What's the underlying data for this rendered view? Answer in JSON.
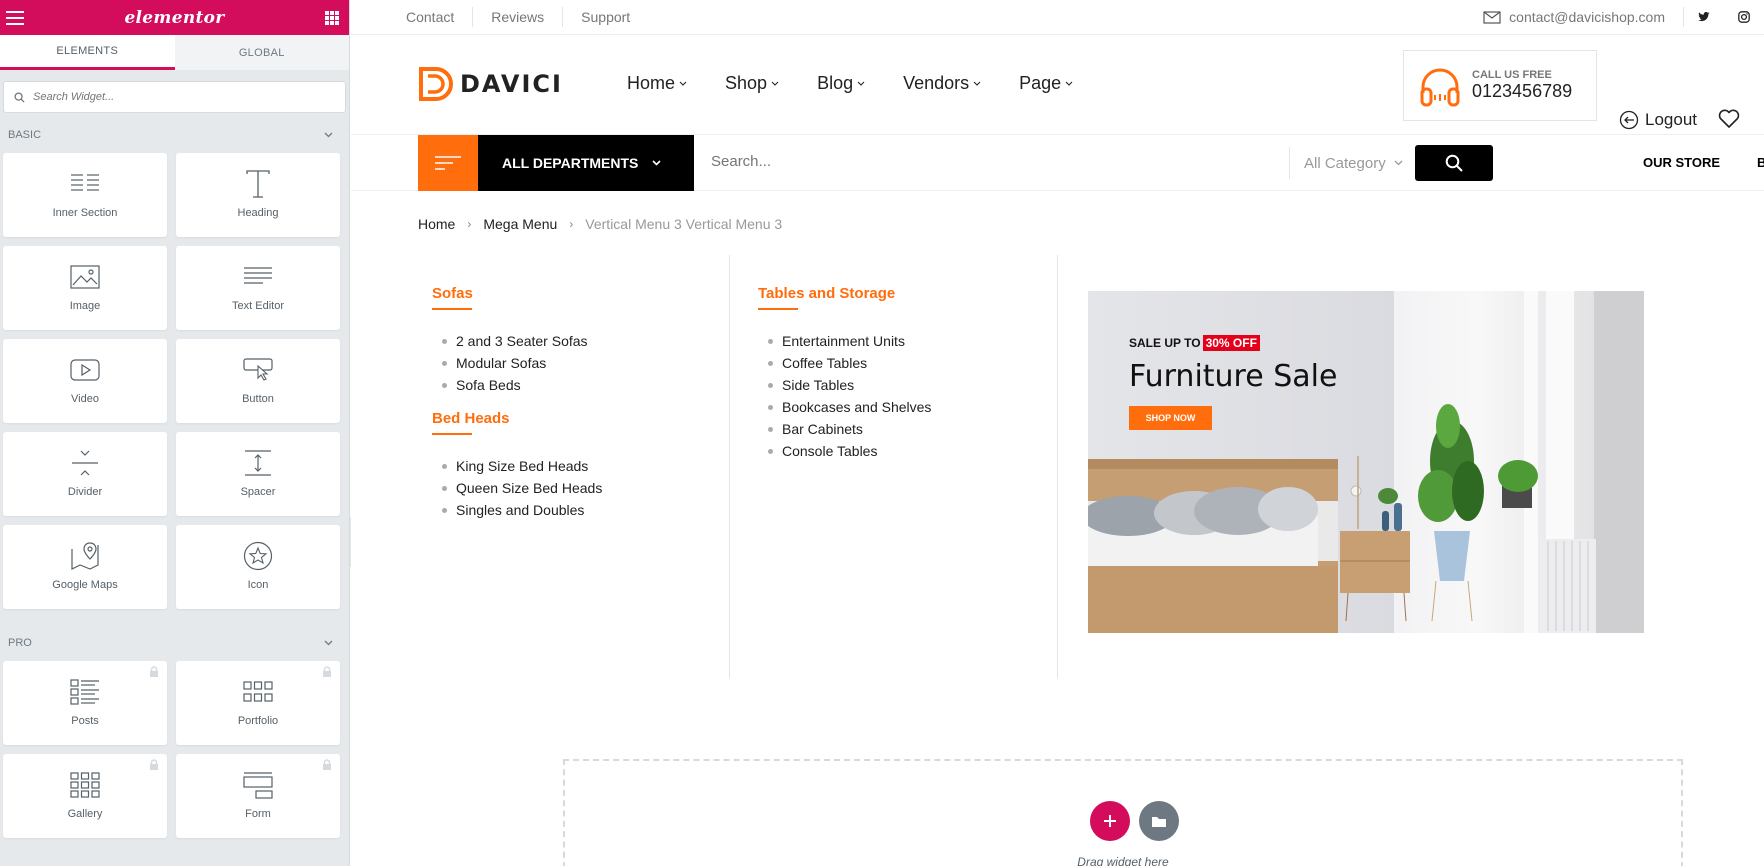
{
  "panel": {
    "logo": "elementor",
    "tabs": [
      "Elements",
      "Global"
    ],
    "search_placeholder": "Search Widget...",
    "basic_title": "Basic",
    "pro_title": "Pro",
    "basic_widgets": [
      "Inner Section",
      "Heading",
      "Image",
      "Text Editor",
      "Video",
      "Button",
      "Divider",
      "Spacer",
      "Google Maps",
      "Icon"
    ],
    "pro_widgets": [
      "Posts",
      "Portfolio",
      "Gallery",
      "Form"
    ]
  },
  "topbar": {
    "links": [
      "Contact",
      "Reviews",
      "Support"
    ],
    "email": "contact@davicishop.com"
  },
  "header": {
    "brand": "DAVICI",
    "nav": [
      "Home",
      "Shop",
      "Blog",
      "Vendors",
      "Page"
    ],
    "call_label": "CALL US FREE",
    "call_number": "0123456789",
    "logout": "Logout"
  },
  "searchbar": {
    "departments": "ALL DEPARTMENTS",
    "placeholder": "Search...",
    "category": "All Category",
    "store_link": "OUR STORE",
    "cut_link": "B"
  },
  "breadcrumb": {
    "items": [
      "Home",
      "Mega Menu"
    ],
    "current": "Vertical Menu 3 Vertical Menu 3"
  },
  "mega": {
    "col1": [
      {
        "title": "Sofas",
        "items": [
          "2 and 3 Seater Sofas",
          "Modular Sofas",
          "Sofa Beds"
        ]
      },
      {
        "title": "Bed Heads",
        "items": [
          "King Size Bed Heads",
          "Queen Size Bed Heads",
          "Singles and Doubles"
        ]
      }
    ],
    "col2": [
      {
        "title": "Tables and Storage",
        "items": [
          "Entertainment Units",
          "Coffee Tables",
          "Side Tables",
          "Bookcases and Shelves",
          "Bar Cabinets",
          "Console Tables"
        ]
      }
    ]
  },
  "banner": {
    "sale_prefix": "SALE UP TO",
    "sale_tag": "30% OFF",
    "title": "Furniture Sale",
    "button": "SHOP NOW"
  },
  "dropzone": {
    "text": "Drag widget here"
  },
  "colors": {
    "elementor": "#d30c5c",
    "accent": "#ff6d0d",
    "dark": "#000000"
  }
}
